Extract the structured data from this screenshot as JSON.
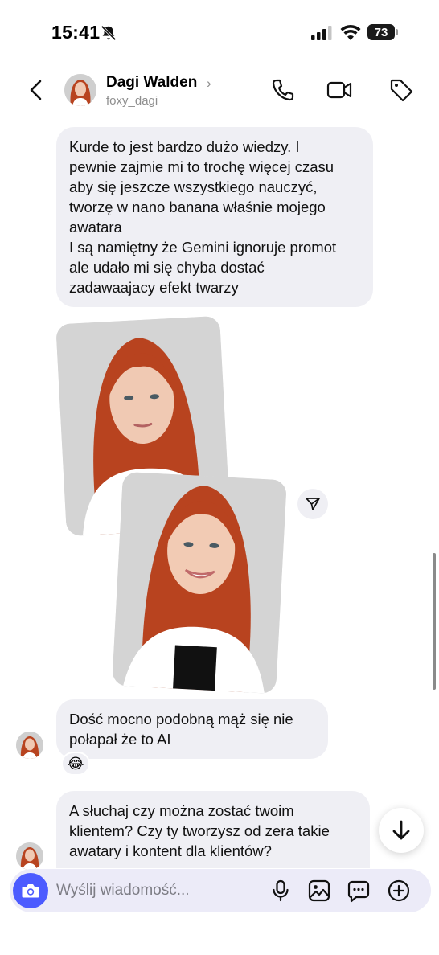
{
  "status_bar": {
    "time": "15:41",
    "battery": "73"
  },
  "header": {
    "name": "Dagi Walden",
    "chevron": "›",
    "username": "foxy_dagi"
  },
  "messages": {
    "first": {
      "lines": [
        "Kurde to jest bardzo dużo wiedzy. I",
        "pewnie zajmie mi to trochę więcej czasu",
        "aby się jeszcze wszystkiego nauczyć,",
        "tworzę w nano banana właśnie mojego",
        "awatara",
        "I są namiętny że Gemini ignoruje promot",
        "ale udało mi się chyba dostać",
        "zadawaajacy efekt twarzy"
      ]
    },
    "second": {
      "lines": [
        "Dość mocno podobną mąż się nie",
        "połapał że to AI"
      ],
      "reaction": "😂"
    },
    "third": {
      "lines": [
        "A słuchaj czy można zostać twoim",
        "klientem? Czy ty tworzysz od zera takie",
        "awatary i kontent dla klientów?"
      ]
    }
  },
  "composer": {
    "placeholder": "Wyślij wiadomość..."
  },
  "colors": {
    "accent": "#4c5bff",
    "bubble": "#efeff4",
    "composer_bg": "#ecebf8",
    "hair": "#b8431f"
  },
  "icons": [
    "bell-off-icon",
    "signal-icon",
    "wifi-icon",
    "battery-icon",
    "back-arrow-icon",
    "phone-icon",
    "video-icon",
    "tag-icon",
    "share-icon",
    "arrow-down-icon",
    "camera-icon",
    "microphone-icon",
    "gallery-icon",
    "sticker-icon",
    "plus-icon"
  ]
}
